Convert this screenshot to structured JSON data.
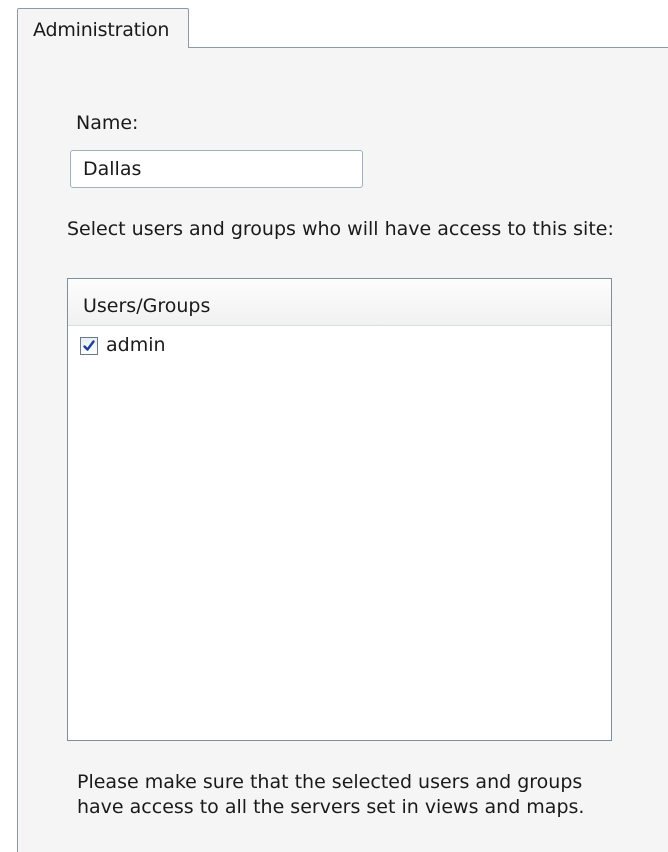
{
  "tabs": [
    {
      "label": "Administration",
      "active": true
    }
  ],
  "form": {
    "name_label": "Name:",
    "name_value": "Dallas",
    "access_prompt": "Select users and groups who will have access to this site:"
  },
  "users_list": {
    "column_header": "Users/Groups",
    "items": [
      {
        "label": "admin",
        "checked": true
      }
    ]
  },
  "note": {
    "line1": "Please make sure that the selected users and groups",
    "line2": "have access to all the servers set in views and maps."
  },
  "colors": {
    "pane_background": "#f5f5f5",
    "border": "#8c9aa8",
    "check_mark": "#1c3f9a"
  },
  "icons": {
    "checkbox_state": "checkmark-icon"
  }
}
